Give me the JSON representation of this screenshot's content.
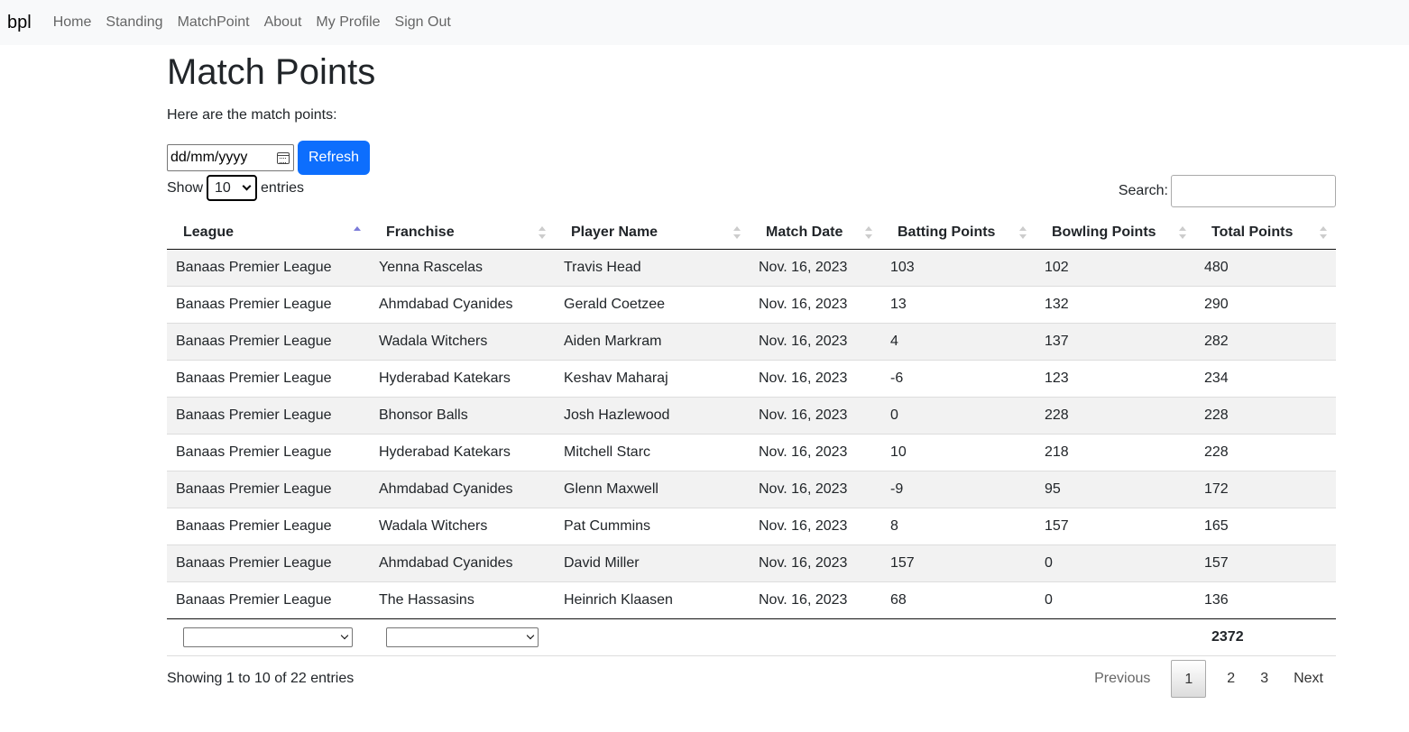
{
  "nav": {
    "brand": "bpl",
    "links": [
      "Home",
      "Standing",
      "MatchPoint",
      "About",
      "My Profile",
      "Sign Out"
    ]
  },
  "page": {
    "title": "Match Points",
    "intro": "Here are the match points:"
  },
  "filter": {
    "date_placeholder": "dd/mm/yyyy",
    "refresh_label": "Refresh"
  },
  "length_control": {
    "show_label": "Show",
    "selected": "10",
    "entries_label": "entries"
  },
  "search": {
    "label": "Search:",
    "value": ""
  },
  "table": {
    "columns": [
      "League",
      "Franchise",
      "Player Name",
      "Match Date",
      "Batting Points",
      "Bowling Points",
      "Total Points"
    ],
    "sorted_column": "League",
    "sort_direction": "asc",
    "rows": [
      [
        "Banaas Premier League",
        "Yenna Rascelas",
        "Travis Head",
        "Nov. 16, 2023",
        "103",
        "102",
        "480"
      ],
      [
        "Banaas Premier League",
        "Ahmdabad Cyanides",
        "Gerald Coetzee",
        "Nov. 16, 2023",
        "13",
        "132",
        "290"
      ],
      [
        "Banaas Premier League",
        "Wadala Witchers",
        "Aiden Markram",
        "Nov. 16, 2023",
        "4",
        "137",
        "282"
      ],
      [
        "Banaas Premier League",
        "Hyderabad Katekars",
        "Keshav Maharaj",
        "Nov. 16, 2023",
        "-6",
        "123",
        "234"
      ],
      [
        "Banaas Premier League",
        "Bhonsor Balls",
        "Josh Hazlewood",
        "Nov. 16, 2023",
        "0",
        "228",
        "228"
      ],
      [
        "Banaas Premier League",
        "Hyderabad Katekars",
        "Mitchell Starc",
        "Nov. 16, 2023",
        "10",
        "218",
        "228"
      ],
      [
        "Banaas Premier League",
        "Ahmdabad Cyanides",
        "Glenn Maxwell",
        "Nov. 16, 2023",
        "-9",
        "95",
        "172"
      ],
      [
        "Banaas Premier League",
        "Wadala Witchers",
        "Pat Cummins",
        "Nov. 16, 2023",
        "8",
        "157",
        "165"
      ],
      [
        "Banaas Premier League",
        "Ahmdabad Cyanides",
        "David Miller",
        "Nov. 16, 2023",
        "157",
        "0",
        "157"
      ],
      [
        "Banaas Premier League",
        "The Hassasins",
        "Heinrich Klaasen",
        "Nov. 16, 2023",
        "68",
        "0",
        "136"
      ]
    ],
    "footer_total": "2372"
  },
  "info": "Showing 1 to 10 of 22 entries",
  "pagination": {
    "previous": "Previous",
    "pages": [
      "1",
      "2",
      "3"
    ],
    "current": "1",
    "next": "Next"
  }
}
